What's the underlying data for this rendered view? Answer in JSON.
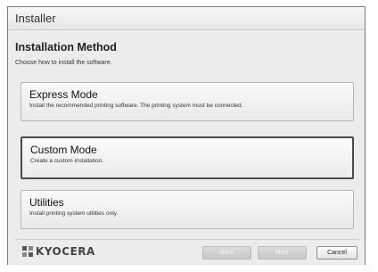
{
  "window": {
    "title": "Installer"
  },
  "page": {
    "heading": "Installation Method",
    "subheading": "Choose how to install the software."
  },
  "options": [
    {
      "title": "Express Mode",
      "description": "Install the recommended printing software. The printing system must be connected."
    },
    {
      "title": "Custom Mode",
      "description": "Create a custom installation."
    },
    {
      "title": "Utilities",
      "description": "Install printing system utilities only."
    }
  ],
  "footer": {
    "logo_text": "KYOCERA",
    "back_label": "Back",
    "next_label": "Next",
    "cancel_label": "Cancel"
  },
  "colors": {
    "selected_border": "#4a4a4a",
    "window_bg": "#ececec"
  }
}
